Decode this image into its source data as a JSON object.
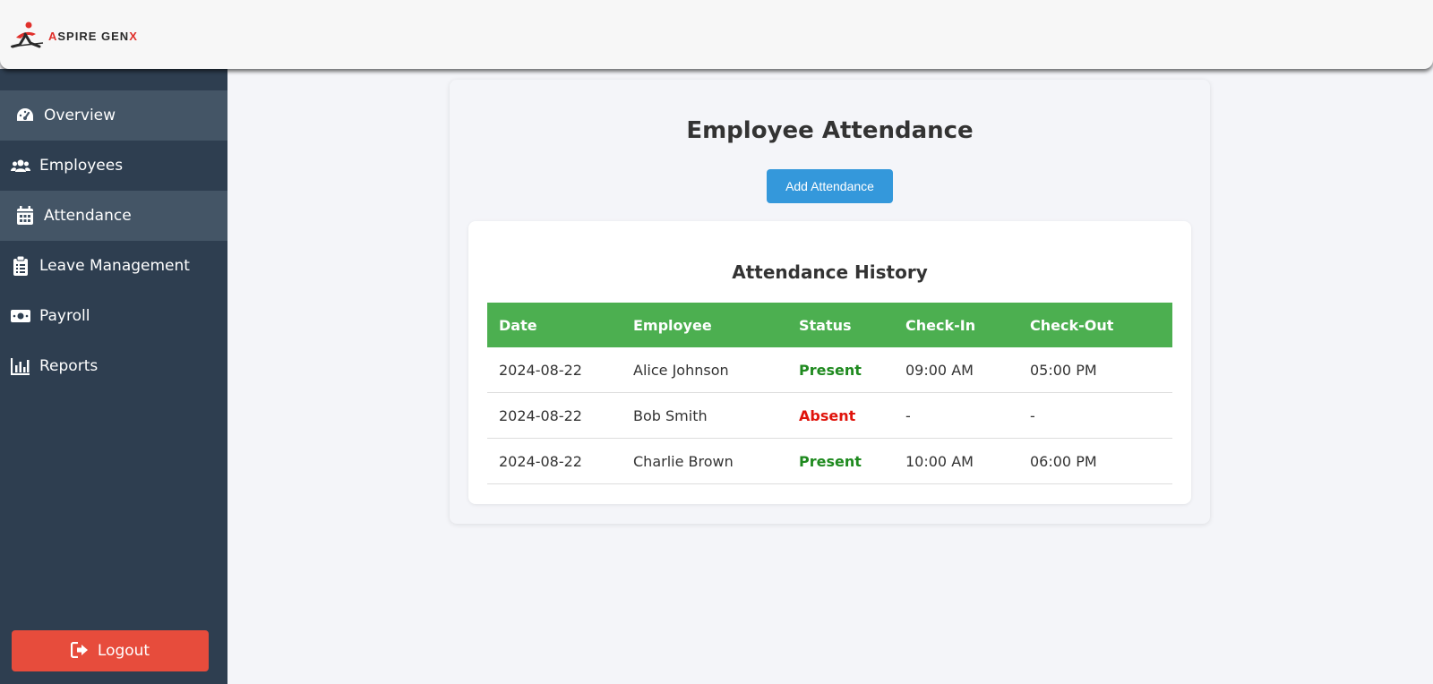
{
  "brand": {
    "name_prefix": "A",
    "name_main": "SPIRE GEN",
    "name_suffix": "X"
  },
  "sidebar": {
    "items": [
      {
        "label": "Overview",
        "icon": "gauge-icon",
        "active": true
      },
      {
        "label": "Employees",
        "icon": "users-icon",
        "active": false
      },
      {
        "label": "Attendance",
        "icon": "calendar-icon",
        "active": true
      },
      {
        "label": "Leave Management",
        "icon": "clipboard-icon",
        "active": false
      },
      {
        "label": "Payroll",
        "icon": "money-icon",
        "active": false
      },
      {
        "label": "Reports",
        "icon": "chart-icon",
        "active": false
      }
    ],
    "logout_label": "Logout"
  },
  "main": {
    "title": "Employee Attendance",
    "add_button_label": "Add Attendance",
    "history_title": "Attendance History",
    "columns": [
      "Date",
      "Employee",
      "Status",
      "Check-In",
      "Check-Out"
    ],
    "rows": [
      {
        "date": "2024-08-22",
        "employee": "Alice Johnson",
        "status": "Present",
        "check_in": "09:00 AM",
        "check_out": "05:00 PM"
      },
      {
        "date": "2024-08-22",
        "employee": "Bob Smith",
        "status": "Absent",
        "check_in": "-",
        "check_out": "-"
      },
      {
        "date": "2024-08-22",
        "employee": "Charlie Brown",
        "status": "Present",
        "check_in": "10:00 AM",
        "check_out": "06:00 PM"
      }
    ]
  },
  "colors": {
    "sidebar_bg": "#2e3e50",
    "active_item_bg": "#445566",
    "header_row_bg": "#4caf50",
    "add_button_bg": "#3498db",
    "logout_bg": "#e74c3c",
    "present": "#1f8a1f",
    "absent": "#e0140c"
  }
}
